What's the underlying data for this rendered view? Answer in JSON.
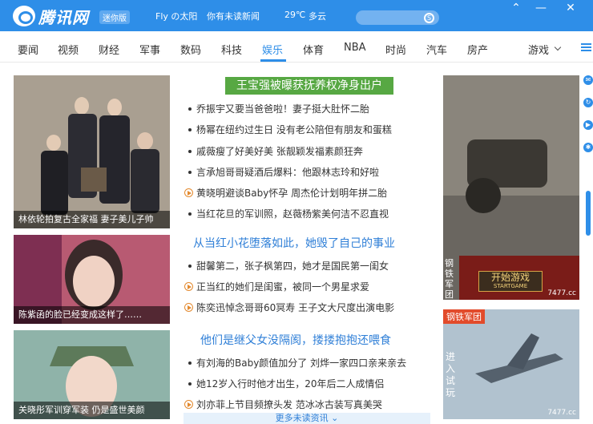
{
  "header": {
    "brand": "腾讯网",
    "edition_badge": "迷你版",
    "user_text": "Fly の太阳",
    "news_notice": "你有未读新闻",
    "weather_temp": "29℃",
    "weather_desc": "多云"
  },
  "window_buttons": {
    "pin": "⌃",
    "minimize": "—",
    "close": "✕"
  },
  "nav": {
    "items": [
      "要闻",
      "视频",
      "财经",
      "军事",
      "数码",
      "科技",
      "娱乐",
      "体育",
      "NBA",
      "时尚",
      "汽车",
      "房产"
    ],
    "active": "娱乐",
    "more_dropdown": "游戏"
  },
  "left_images": [
    {
      "caption": "林依轮拍复古全家福 妻子美儿子帅"
    },
    {
      "caption": "陈紫函的脸已经变成这样了……"
    },
    {
      "caption": "关晓彤军训穿军装 仍是盛世美颜"
    }
  ],
  "section1": {
    "headline": "王宝强被曝获抚养权净身出户",
    "items": [
      {
        "text": "乔振宇又要当爸爸啦！妻子挺大肚怀二胎",
        "video": false
      },
      {
        "text": "杨幂在纽约过生日 没有老公陪但有朋友和蛋糕",
        "video": false
      },
      {
        "text": "戚薇瘦了好美好美 张靓颖发福素颜狂奔",
        "video": false
      },
      {
        "text": "言承旭哥哥疑酒后爆料：他跟林志玲和好啦",
        "video": false
      },
      {
        "text": "黄晓明避谈Baby怀孕 周杰伦计划明年拼二胎",
        "video": true
      },
      {
        "text": "当红花旦的军训照，赵薇杨紫美何洁不忍直视",
        "video": false
      }
    ]
  },
  "section2": {
    "headline": "从当红小花堕落如此，她毁了自己的事业",
    "items": [
      {
        "text": "甜馨第二，张子枫第四，她才是国民第一闺女",
        "video": false
      },
      {
        "text": "正当红的她们是闺蜜，被同一个男星求爱",
        "video": true
      },
      {
        "text": "陈奕迅悼念哥哥60冥寿 王子文大尺度出演电影",
        "video": true
      }
    ]
  },
  "section3": {
    "headline": "他们是继父女没隔阂，搂搂抱抱还喂食",
    "items": [
      {
        "text": "有刘海的Baby颜值加分了 刘烨一家四口亲来亲去",
        "video": false
      },
      {
        "text": "她12岁入行时他才出生，20年后二人成情侣",
        "video": false
      },
      {
        "text": "刘亦菲上节目频撩头发 范冰冰古装写真美哭",
        "video": true
      }
    ]
  },
  "more_link": "更多未读资讯",
  "ads": [
    {
      "side_text": "钢铁军团",
      "button_text": "开始游戏",
      "button_sub": "STARTGAME",
      "site": "7477.cc"
    },
    {
      "tag": "钢铁军团",
      "side_text": "进入试玩",
      "site": "7477.cc"
    }
  ],
  "colors": {
    "brand_blue": "#2e8ee8",
    "headline_green": "#57a843",
    "link_blue": "#2f7fd7"
  }
}
